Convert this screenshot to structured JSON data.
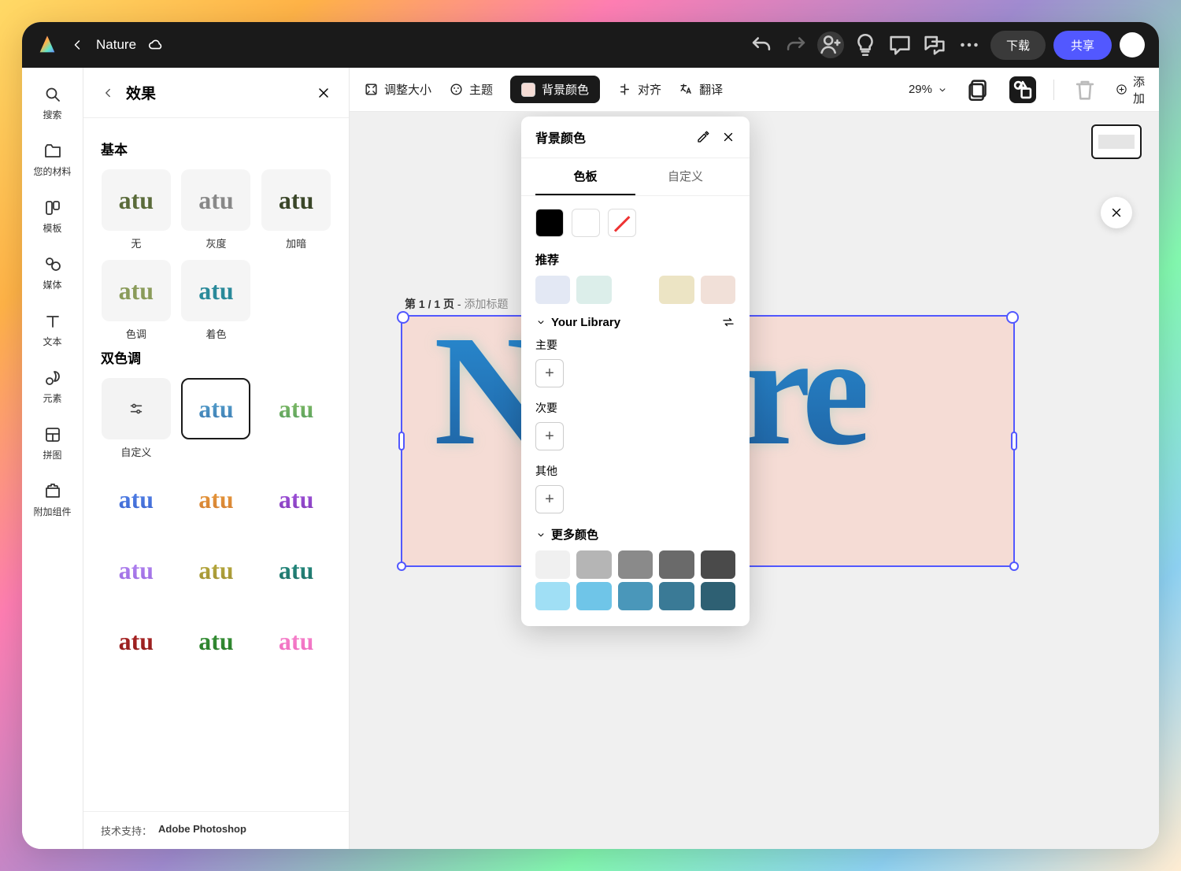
{
  "topbar": {
    "doc_title": "Nature",
    "download": "下载",
    "share": "共享"
  },
  "rail": {
    "search": "搜索",
    "your_stuff": "您的材料",
    "templates": "模板",
    "media": "媒体",
    "text": "文本",
    "elements": "元素",
    "grids": "拼图",
    "addons": "附加组件"
  },
  "effects": {
    "title": "效果",
    "section_basic": "基本",
    "basic_items": {
      "none": "无",
      "grayscale": "灰度",
      "darken": "加暗",
      "tint": "色调",
      "colorize": "着色"
    },
    "section_duotone": "双色调",
    "duotone_custom": "自定义",
    "footer_label": "技术支持：",
    "footer_brand": "Adobe Photoshop"
  },
  "toolbar": {
    "resize": "调整大小",
    "theme": "主题",
    "bg_color": "背景颜色",
    "align": "对齐",
    "translate": "翻译",
    "zoom": "29%",
    "add": "添加"
  },
  "canvas": {
    "page_label": "第 1 / 1 页",
    "add_title": "添加标题",
    "text": "Nature"
  },
  "popover": {
    "title": "背景颜色",
    "tab_swatch": "色板",
    "tab_custom": "自定义",
    "recommended": "推荐",
    "your_library": "Your Library",
    "primary": "主要",
    "secondary": "次要",
    "other": "其他",
    "more_colors": "更多颜色",
    "rec_colors": [
      "#e3e8f4",
      "#dceeea",
      "#ffffff",
      "#ece4c4",
      "#f1e0d8"
    ],
    "more_row1": [
      "#f0f0f0",
      "#b5b5b5",
      "#8a8a8a",
      "#6a6a6a",
      "#4a4a4a"
    ],
    "more_row2": [
      "#a0dff5",
      "#6fc5e8",
      "#4a97ba",
      "#3a7a96",
      "#2e6073"
    ]
  }
}
